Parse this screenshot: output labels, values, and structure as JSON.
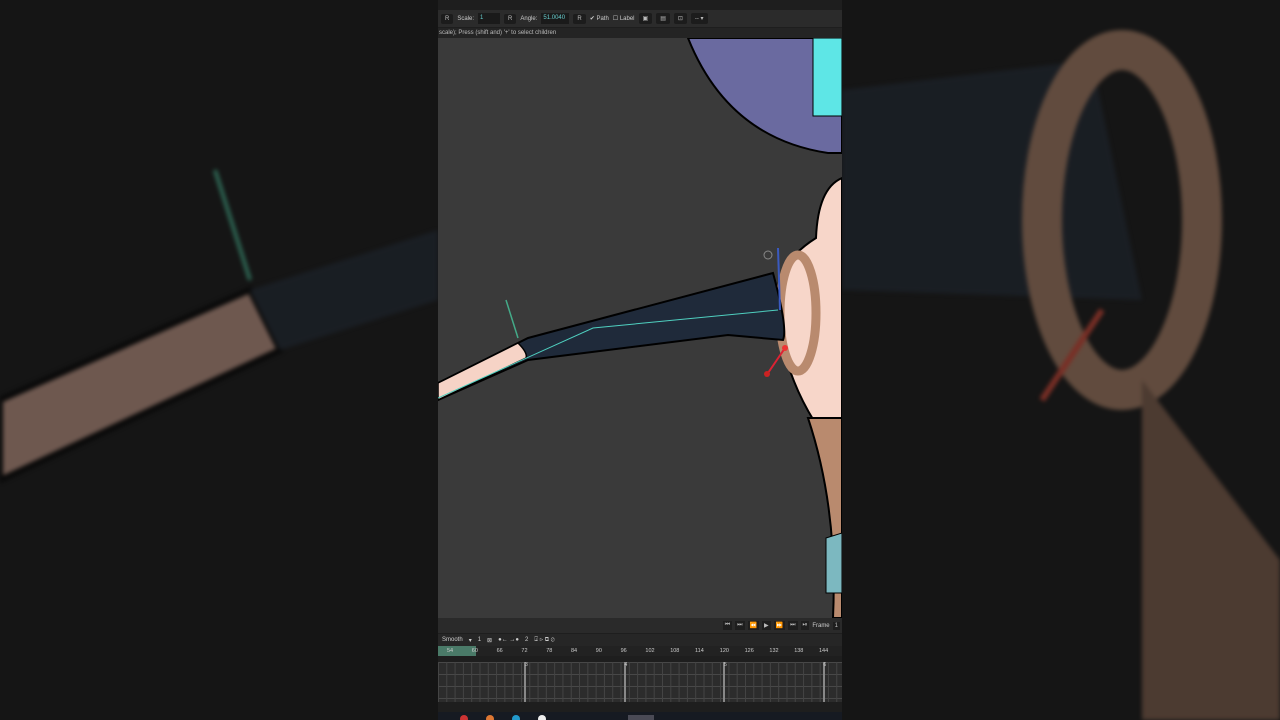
{
  "toolbar": {
    "r1": "R",
    "scale_label": "Scale:",
    "scale_value": "1",
    "r2": "R",
    "angle_label": "Angle:",
    "angle_value": "51.0040",
    "r3": "R",
    "path_label": "Path",
    "path_checked": true,
    "label_label": "Label",
    "label_checked": false,
    "more": "-- ▾"
  },
  "status": "scale); Press (shift and) '+' to select children",
  "playback": {
    "buttons": [
      "⏮",
      "⏭",
      "⏪",
      "▶",
      "⏩",
      "⏭",
      "⏯"
    ],
    "frame_label": "Frame",
    "frame_value": "1"
  },
  "timeline": {
    "interp": "Smooth",
    "interp_value": "1",
    "keys_count": "2",
    "ruler": [
      "54",
      "60",
      "66",
      "72",
      "78",
      "84",
      "90",
      "96",
      "102",
      "108",
      "114",
      "120",
      "126",
      "132",
      "138",
      "144"
    ],
    "seconds": [
      "3",
      "4",
      "5",
      "6"
    ]
  },
  "colors": {
    "canvas": "#3a3a3a",
    "arm": "#1f2a3a",
    "skin": "#f6d3c6",
    "bone": "#4fd0c0",
    "accent_teal": "#4a7a68"
  }
}
